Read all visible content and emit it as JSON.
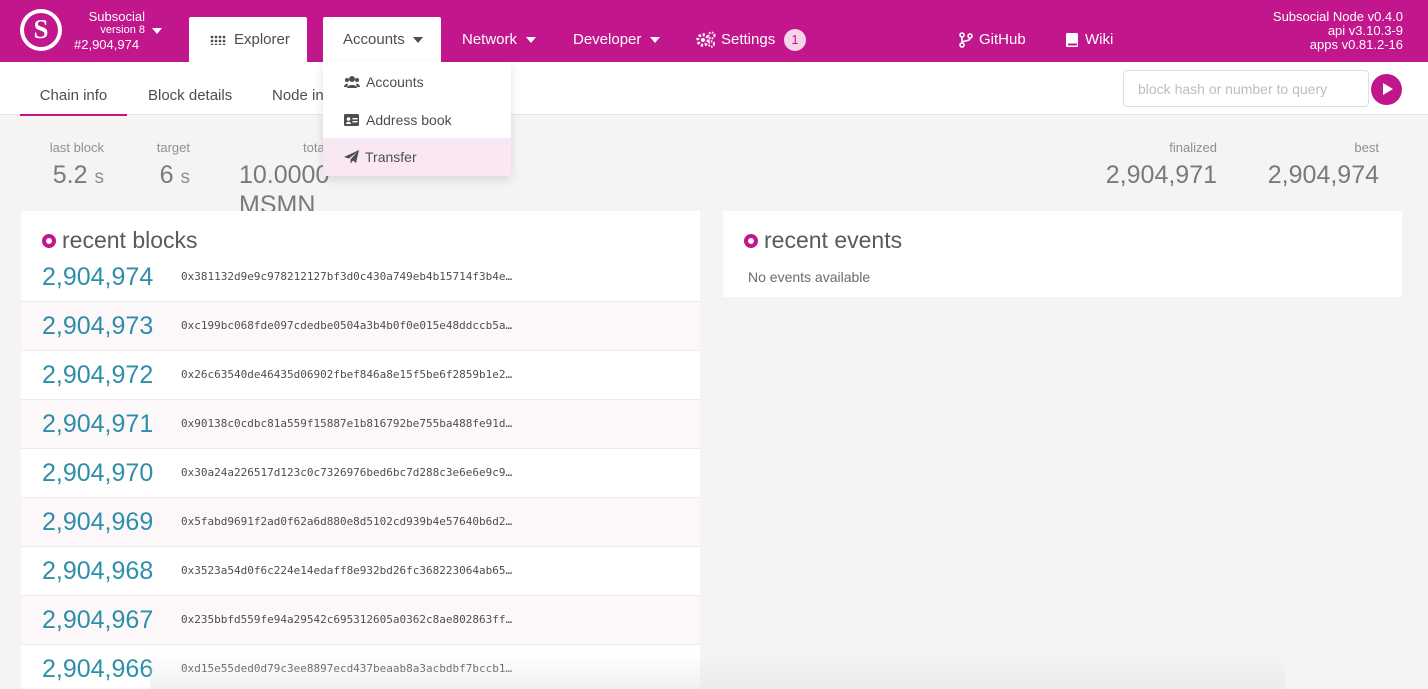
{
  "chain": {
    "name": "Subsocial",
    "version": "version 8",
    "block": "#2,904,974",
    "logo_letter": "S"
  },
  "nav": {
    "explorer": "Explorer",
    "accounts": "Accounts",
    "network": "Network",
    "developer": "Developer",
    "settings": "Settings",
    "settings_badge": "1",
    "github": "GitHub",
    "wiki": "Wiki"
  },
  "node": {
    "name": "Subsocial Node v0.4.0",
    "api": "api v3.10.3-9",
    "apps": "apps v0.81.2-16"
  },
  "accounts_menu": {
    "items": [
      "Accounts",
      "Address book",
      "Transfer"
    ]
  },
  "subnav": {
    "tabs": [
      "Chain info",
      "Block details",
      "Node inf"
    ],
    "query_placeholder": "block hash or number to query"
  },
  "summary": {
    "last_block": {
      "label": "last block",
      "value": "5.2",
      "unit": "s"
    },
    "target": {
      "label": "target",
      "value": "6",
      "unit": "s"
    },
    "total_issuance": {
      "label": "tota",
      "value": "10.0000 MSMN"
    },
    "finalized": {
      "label": "finalized",
      "value": "2,904,971"
    },
    "best": {
      "label": "best",
      "value": "2,904,974"
    }
  },
  "recent_blocks": {
    "title": "recent blocks",
    "rows": [
      {
        "number": "2,904,974",
        "hash": "0x381132d9e9c978212127bf3d0c430a749eb4b15714f3b4e…"
      },
      {
        "number": "2,904,973",
        "hash": "0xc199bc068fde097cdedbe0504a3b4b0f0e015e48ddccb5a…"
      },
      {
        "number": "2,904,972",
        "hash": "0x26c63540de46435d06902fbef846a8e15f5be6f2859b1e2…"
      },
      {
        "number": "2,904,971",
        "hash": "0x90138c0cdbc81a559f15887e1b816792be755ba488fe91d…"
      },
      {
        "number": "2,904,970",
        "hash": "0x30a24a226517d123c0c7326976bed6bc7d288c3e6e6e9c9…"
      },
      {
        "number": "2,904,969",
        "hash": "0x5fabd9691f2ad0f62a6d880e8d5102cd939b4e57640b6d2…"
      },
      {
        "number": "2,904,968",
        "hash": "0x3523a54d0f6c224e14edaff8e932bd26fc368223064ab65…"
      },
      {
        "number": "2,904,967",
        "hash": "0x235bbfd559fe94a29542c695312605a0362c8ae802863ff…"
      },
      {
        "number": "2,904,966",
        "hash": "0xd15e55ded0d79c3ee8897ecd437beaab8a3acbdbf7bccb1…"
      }
    ]
  },
  "recent_events": {
    "title": "recent events",
    "empty": "No events available"
  },
  "colors": {
    "brand": "#c2168d",
    "block_link": "#2d8fa8",
    "menu_hover": "#f9e8f3"
  }
}
